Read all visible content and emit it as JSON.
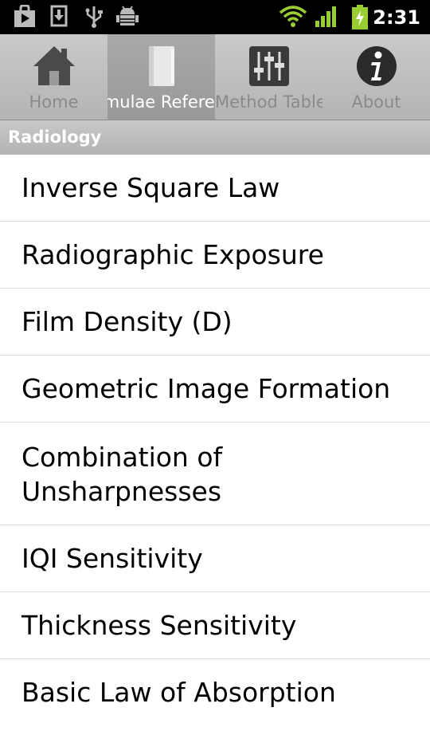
{
  "status_bar": {
    "time": "2:31",
    "icons": [
      "bag-icon",
      "download-icon",
      "usb-icon",
      "android-debug-icon",
      "wifi-icon",
      "signal-icon",
      "battery-charging-icon"
    ]
  },
  "tabs": [
    {
      "label": "Home",
      "icon": "home-icon",
      "selected": false
    },
    {
      "label": "Formulae Reference",
      "icon": "book-icon",
      "selected": true
    },
    {
      "label": "Method Table",
      "icon": "equalizer-icon",
      "selected": false
    },
    {
      "label": "About",
      "icon": "info-icon",
      "selected": false
    }
  ],
  "section": {
    "title": "Radiology"
  },
  "list": {
    "items": [
      "Inverse Square Law",
      "Radiographic Exposure",
      "Film Density (D)",
      "Geometric Image Formation",
      "Combination of Unsharpnesses",
      "IQI Sensitivity",
      "Thickness Sensitivity",
      "Basic Law of Absorption"
    ]
  },
  "colors": {
    "status_bar": "#000000",
    "tab_bar": "#bdbdbd",
    "tab_selected": "#a0a0a0",
    "tab_label": "#8a8a8a",
    "tab_label_selected": "#ffffff",
    "section_header": "#bdbdbd",
    "battery_green": "#9acd32",
    "divider": "#dcdcdc"
  }
}
